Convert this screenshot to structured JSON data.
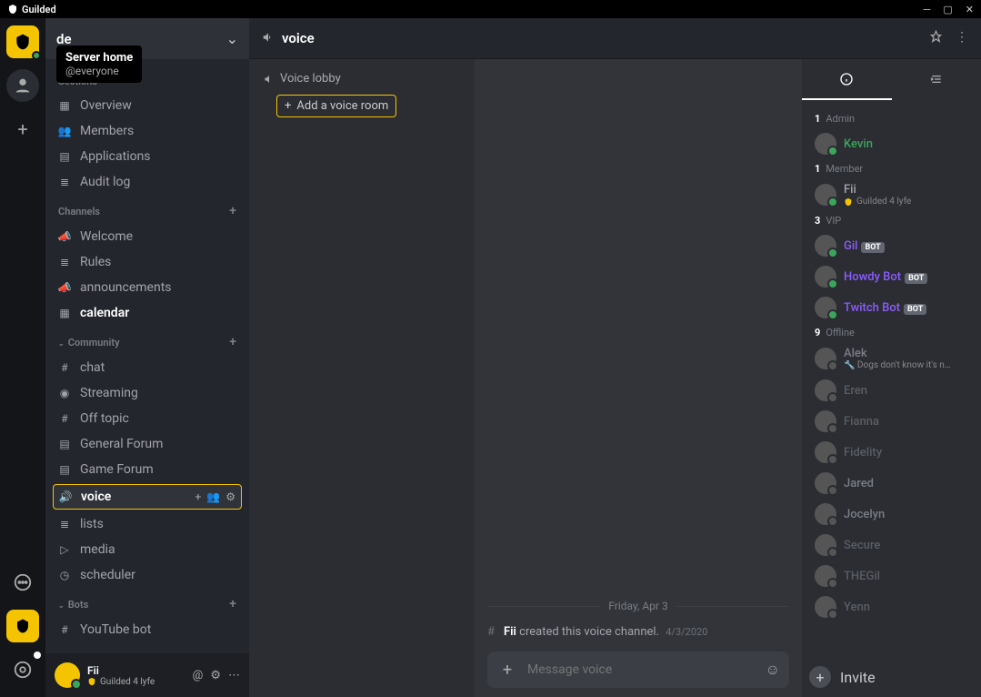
{
  "titlebar": {
    "app_name": "Guilded"
  },
  "tooltip": {
    "title": "Server home",
    "sub": "@everyone"
  },
  "server": {
    "name": "de"
  },
  "sidebar": {
    "sections_label": "Sections",
    "channels_label": "Channels",
    "community_label": "Community",
    "bots_label": "Bots",
    "sections": [
      {
        "icon": "grid",
        "label": "Overview"
      },
      {
        "icon": "people",
        "label": "Members"
      },
      {
        "icon": "apps",
        "label": "Applications"
      },
      {
        "icon": "log",
        "label": "Audit log"
      }
    ],
    "channels": [
      {
        "icon": "mega",
        "label": "Welcome"
      },
      {
        "icon": "doc",
        "label": "Rules"
      },
      {
        "icon": "mega",
        "label": "announcements"
      },
      {
        "icon": "cal",
        "label": "calendar",
        "bold": true
      }
    ],
    "community": [
      {
        "icon": "hash",
        "label": "chat"
      },
      {
        "icon": "stream",
        "label": "Streaming"
      },
      {
        "icon": "hash",
        "label": "Off topic"
      },
      {
        "icon": "forum",
        "label": "General Forum"
      },
      {
        "icon": "forum",
        "label": "Game Forum"
      },
      {
        "icon": "voice",
        "label": "voice",
        "active": true
      },
      {
        "icon": "list",
        "label": "lists"
      },
      {
        "icon": "media",
        "label": "media"
      },
      {
        "icon": "clock",
        "label": "scheduler"
      }
    ],
    "bots": [
      {
        "icon": "hash",
        "label": "YouTube bot"
      }
    ]
  },
  "user_footer": {
    "name": "Fii",
    "status": "Guilded 4 lyfe"
  },
  "header": {
    "channel_name": "voice"
  },
  "rooms": {
    "lobby_label": "Voice lobby",
    "add_label": "Add a voice room"
  },
  "chat": {
    "date": "Friday, Apr 3",
    "system": {
      "author": "Fii",
      "text": " created this voice channel.",
      "ts": "4/3/2020"
    },
    "composer_placeholder": "Message voice"
  },
  "members": {
    "groups": [
      {
        "count": "1",
        "label": "Admin",
        "items": [
          {
            "name": "Kevin",
            "class": "admin-name",
            "online": true
          }
        ]
      },
      {
        "count": "1",
        "label": "Member",
        "items": [
          {
            "name": "Fii",
            "class": "",
            "online": true,
            "status": "Guilded 4 lyfe",
            "gbadge": true
          }
        ]
      },
      {
        "count": "3",
        "label": "VIP",
        "items": [
          {
            "name": "Gil",
            "class": "vip-name",
            "online": true,
            "bot": true
          },
          {
            "name": "Howdy Bot",
            "class": "vip-name",
            "online": true,
            "bot": true
          },
          {
            "name": "Twitch Bot",
            "class": "vip-name",
            "online": true,
            "bot": true
          }
        ]
      },
      {
        "count": "9",
        "label": "Offline",
        "items": [
          {
            "name": "Alek",
            "class": "admin-name off-name",
            "online": false,
            "status": "🔧 Dogs don't know it's n…"
          },
          {
            "name": "Eren",
            "class": "member-off",
            "online": false
          },
          {
            "name": "Fianna",
            "class": "member-off",
            "online": false
          },
          {
            "name": "Fidelity",
            "class": "member-off",
            "online": false
          },
          {
            "name": "Jared",
            "class": "admin-name off-name",
            "online": false
          },
          {
            "name": "Jocelyn",
            "class": "vip-name off-name",
            "online": false
          },
          {
            "name": "Secure",
            "class": "member-off",
            "online": false
          },
          {
            "name": "THEGil",
            "class": "member-off",
            "online": false
          },
          {
            "name": "Yenn",
            "class": "member-off",
            "online": false
          }
        ]
      }
    ],
    "invite_label": "Invite",
    "bot_tag": "BOT"
  }
}
